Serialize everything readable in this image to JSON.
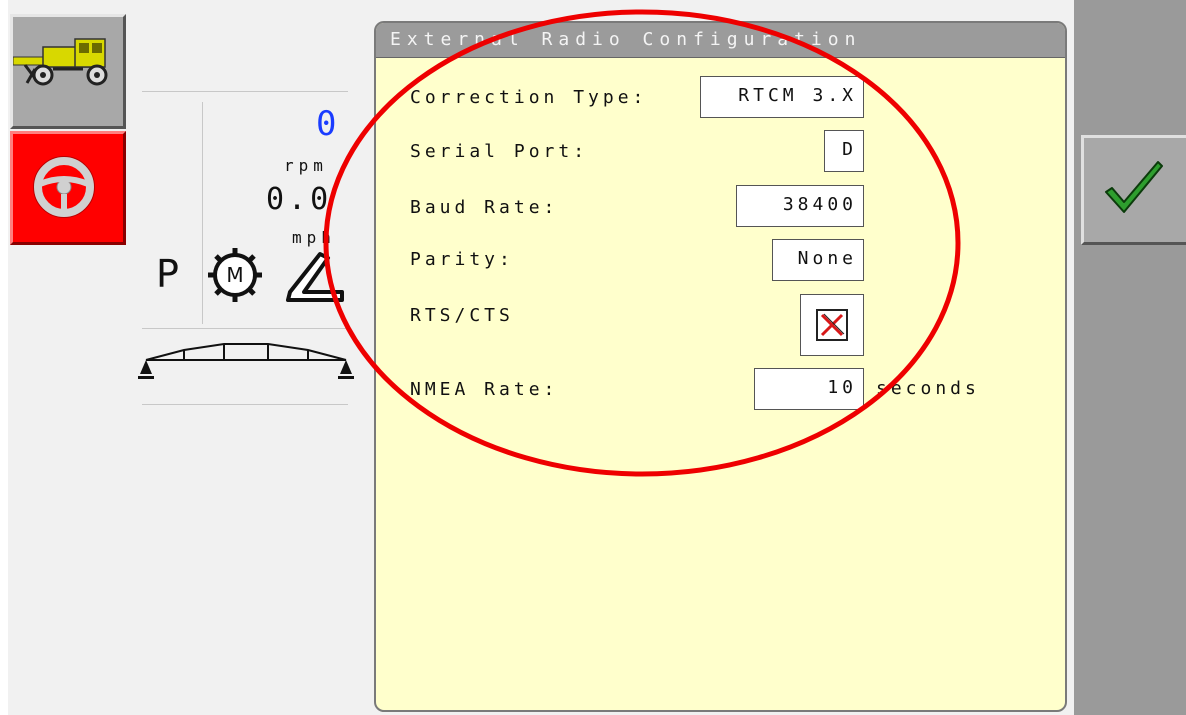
{
  "left_toolbar": {
    "vehicle_icon": "sprayer-vehicle-icon",
    "steering_icon": "steering-wheel-icon",
    "steering_bg": "#ff0000"
  },
  "gauges": {
    "rpm_value": "0",
    "rpm_unit": "rpm",
    "speed_value": "0.0",
    "speed_unit": "mph",
    "gear": "P",
    "rpm_color": "#1a3cff"
  },
  "dialog": {
    "title": "External Radio Configuration",
    "background": "#ffffcc",
    "fields": {
      "correction_type": {
        "label": "Correction Type:",
        "value": "RTCM 3.X"
      },
      "serial_port": {
        "label": "Serial Port:",
        "value": "D"
      },
      "baud_rate": {
        "label": "Baud Rate:",
        "value": "38400"
      },
      "parity": {
        "label": "Parity:",
        "value": "None"
      },
      "rts_cts": {
        "label": "RTS/CTS",
        "checked": false
      },
      "nmea_rate": {
        "label": "NMEA Rate:",
        "value": "10",
        "unit": "seconds"
      }
    }
  },
  "right_toolbar": {
    "confirm_icon": "checkmark-icon",
    "confirm_color": "#2e9e2e"
  },
  "annotation": {
    "shape": "ellipse",
    "color": "#ee0000"
  }
}
